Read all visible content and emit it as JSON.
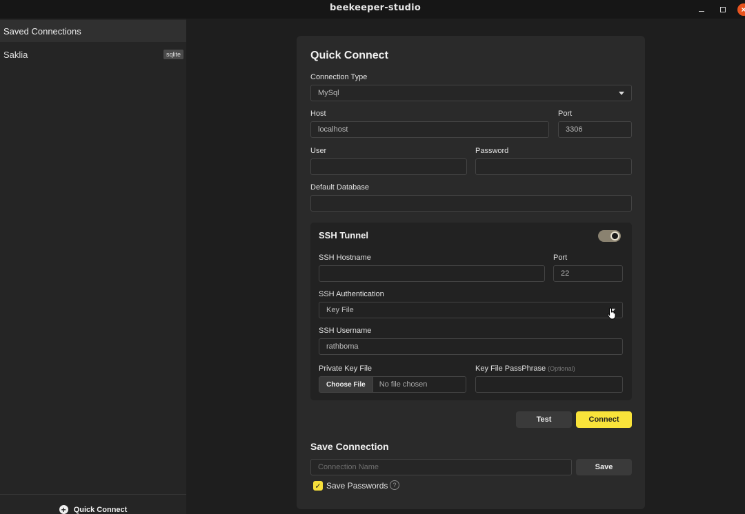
{
  "window": {
    "title": "beekeeper-studio",
    "min_icon": "minimize-icon",
    "max_icon": "maximize-icon",
    "close_icon": "close-icon",
    "close_glyph": "×"
  },
  "sidebar": {
    "header": "Saved Connections",
    "connections": [
      {
        "name": "Saklia",
        "type": "sqlite"
      }
    ],
    "footer_label": "Quick Connect",
    "footer_icon": "plus-circle-icon",
    "footer_glyph": "+"
  },
  "quick_connect": {
    "title": "Quick Connect",
    "connection_type": {
      "label": "Connection Type",
      "value": "MySql"
    },
    "host": {
      "label": "Host",
      "value": "localhost"
    },
    "port": {
      "label": "Port",
      "value": "3306"
    },
    "user": {
      "label": "User",
      "value": ""
    },
    "password": {
      "label": "Password",
      "value": ""
    },
    "default_database": {
      "label": "Default Database",
      "value": ""
    }
  },
  "ssh": {
    "title": "SSH Tunnel",
    "enabled": true,
    "hostname": {
      "label": "SSH Hostname",
      "value": ""
    },
    "port": {
      "label": "Port",
      "value": "22"
    },
    "authentication": {
      "label": "SSH Authentication",
      "value": "Key File"
    },
    "username": {
      "label": "SSH Username",
      "value": "rathboma"
    },
    "private_key": {
      "label": "Private Key File",
      "button": "Choose File",
      "status": "No file chosen"
    },
    "passphrase": {
      "label": "Key File PassPhrase",
      "optional": "(Optional)",
      "value": ""
    }
  },
  "actions": {
    "test": "Test",
    "connect": "Connect"
  },
  "save_connection": {
    "title": "Save Connection",
    "name_placeholder": "Connection Name",
    "save_button": "Save",
    "save_passwords_label": "Save Passwords",
    "save_passwords_checked": true,
    "check_glyph": "✓",
    "help_glyph": "?"
  },
  "colors": {
    "accent_yellow": "#f9e33a",
    "background": "#1e1e1e",
    "panel": "#2a2a2a",
    "close_button": "#e9541f"
  }
}
